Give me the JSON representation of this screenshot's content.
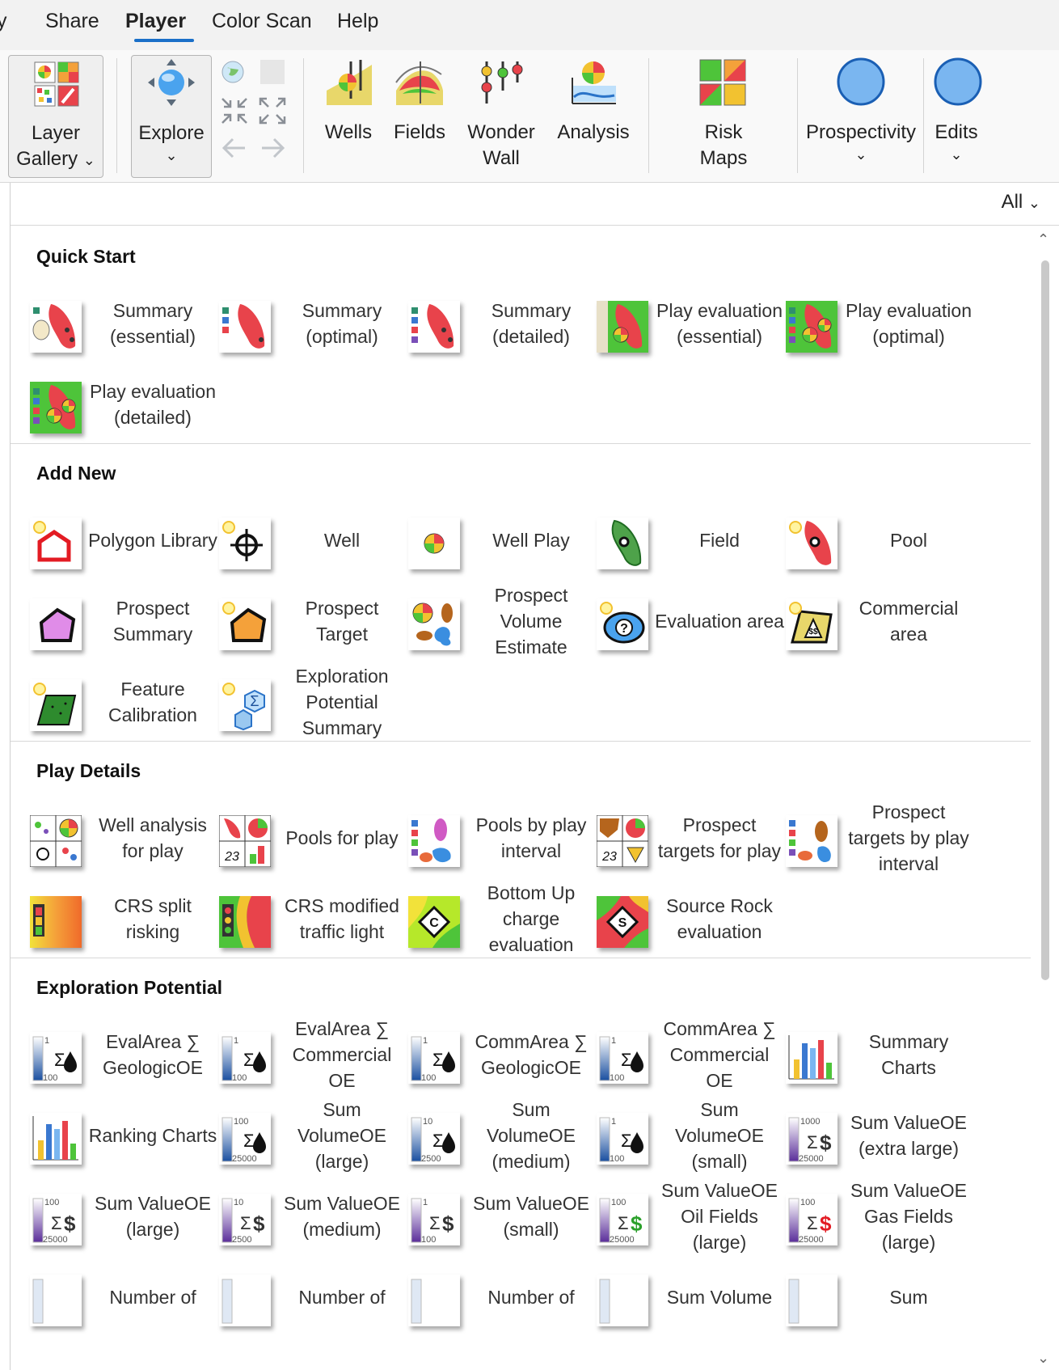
{
  "menu": {
    "tabs": [
      {
        "label": "y"
      },
      {
        "label": "Share"
      },
      {
        "label": "Player"
      },
      {
        "label": "Color Scan"
      },
      {
        "label": "Help"
      }
    ]
  },
  "ribbon": {
    "layer_gallery": {
      "line1": "Layer",
      "line2": "Gallery"
    },
    "explore": "Explore",
    "wells": "Wells",
    "fields": "Fields",
    "wonder_wall": {
      "line1": "Wonder",
      "line2": "Wall"
    },
    "analysis": "Analysis",
    "risk_maps": {
      "line1": "Risk",
      "line2": "Maps"
    },
    "prospectivity": "Prospectivity",
    "edits": "Edits"
  },
  "filter": {
    "value": "All"
  },
  "sections": [
    {
      "title": "Quick Start",
      "items": [
        {
          "label": "Summary (essential)",
          "icon": "summary-essential-icon"
        },
        {
          "label": "Summary (optimal)",
          "icon": "summary-optimal-icon"
        },
        {
          "label": "Summary (detailed)",
          "icon": "summary-detailed-icon"
        },
        {
          "label": "Play evaluation (essential)",
          "icon": "play-eval-essential-icon"
        },
        {
          "label": "Play evaluation (optimal)",
          "icon": "play-eval-optimal-icon"
        },
        {
          "label": "Play evaluation (detailed)",
          "icon": "play-eval-detailed-icon"
        }
      ]
    },
    {
      "title": "Add New",
      "items": [
        {
          "label": "Polygon Library",
          "icon": "polygon-library-icon"
        },
        {
          "label": "Well",
          "icon": "well-icon"
        },
        {
          "label": "Well Play",
          "icon": "well-play-icon"
        },
        {
          "label": "Field",
          "icon": "field-icon"
        },
        {
          "label": "Pool",
          "icon": "pool-icon"
        },
        {
          "label": "Prospect Summary",
          "icon": "prospect-summary-icon"
        },
        {
          "label": "Prospect Target",
          "icon": "prospect-target-icon"
        },
        {
          "label": "Prospect Volume Estimate",
          "icon": "prospect-volume-icon"
        },
        {
          "label": "Evaluation area",
          "icon": "evaluation-area-icon"
        },
        {
          "label": "Commercial area",
          "icon": "commercial-area-icon"
        },
        {
          "label": "Feature Calibration",
          "icon": "feature-calibration-icon"
        },
        {
          "label": "Exploration Potential Summary",
          "icon": "exploration-potential-icon"
        }
      ]
    },
    {
      "title": "Play Details",
      "items": [
        {
          "label": "Well analysis for play",
          "icon": "well-analysis-icon"
        },
        {
          "label": "Pools for play",
          "icon": "pools-for-play-icon"
        },
        {
          "label": "Pools by play interval",
          "icon": "pools-by-interval-icon"
        },
        {
          "label": "Prospect targets for play",
          "icon": "prospect-targets-icon"
        },
        {
          "label": "Prospect targets by play interval",
          "icon": "prospect-targets-interval-icon"
        },
        {
          "label": "CRS split risking",
          "icon": "crs-split-icon"
        },
        {
          "label": "CRS modified traffic light",
          "icon": "crs-traffic-light-icon"
        },
        {
          "label": "Bottom Up charge evaluation",
          "icon": "charge-eval-icon"
        },
        {
          "label": "Source Rock evaluation",
          "icon": "source-rock-icon"
        }
      ]
    },
    {
      "title": "Exploration Potential",
      "items": [
        {
          "label": "EvalArea ∑ GeologicOE",
          "icon": "sum-oil-icon",
          "n1": "1",
          "n2": "100"
        },
        {
          "label": "EvalArea ∑ Commercial OE",
          "icon": "sum-oil-icon",
          "n1": "1",
          "n2": "100"
        },
        {
          "label": "CommArea ∑ GeologicOE",
          "icon": "sum-oil-icon",
          "n1": "1",
          "n2": "100"
        },
        {
          "label": "CommArea ∑ Commercial OE",
          "icon": "sum-oil-icon",
          "n1": "1",
          "n2": "100"
        },
        {
          "label": "Summary Charts",
          "icon": "bar-chart-icon"
        },
        {
          "label": "Ranking Charts",
          "icon": "bar-chart-icon"
        },
        {
          "label": "Sum VolumeOE (large)",
          "icon": "sum-oil-icon",
          "n1": "100",
          "n2": "25000"
        },
        {
          "label": "Sum VolumeOE (medium)",
          "icon": "sum-oil-icon",
          "n1": "10",
          "n2": "2500"
        },
        {
          "label": "Sum VolumeOE (small)",
          "icon": "sum-oil-icon",
          "n1": "1",
          "n2": "100"
        },
        {
          "label": "Sum ValueOE (extra large)",
          "icon": "sum-value-icon",
          "n1": "1000",
          "n2": "25000"
        },
        {
          "label": "Sum ValueOE (large)",
          "icon": "sum-value-icon",
          "n1": "100",
          "n2": "25000"
        },
        {
          "label": "Sum ValueOE (medium)",
          "icon": "sum-value-icon",
          "n1": "10",
          "n2": "2500"
        },
        {
          "label": "Sum ValueOE (small)",
          "icon": "sum-value-icon",
          "n1": "1",
          "n2": "100"
        },
        {
          "label": "Sum ValueOE Oil Fields (large)",
          "icon": "sum-value-oil-icon",
          "n1": "100",
          "n2": "25000"
        },
        {
          "label": "Sum ValueOE Gas Fields (large)",
          "icon": "sum-value-gas-icon",
          "n1": "100",
          "n2": "25000"
        },
        {
          "label": "Number of",
          "icon": "count-icon"
        },
        {
          "label": "Number of",
          "icon": "count-icon"
        },
        {
          "label": "Number of",
          "icon": "count-icon"
        },
        {
          "label": "Sum Volume",
          "icon": "count-icon"
        },
        {
          "label": "Sum",
          "icon": "count-icon"
        }
      ]
    }
  ],
  "colors": {
    "accent": "#1a6fc8",
    "icon_red": "#e8434b",
    "icon_green": "#4ec43a",
    "prospectivity_blue": "#7ab6f0"
  }
}
